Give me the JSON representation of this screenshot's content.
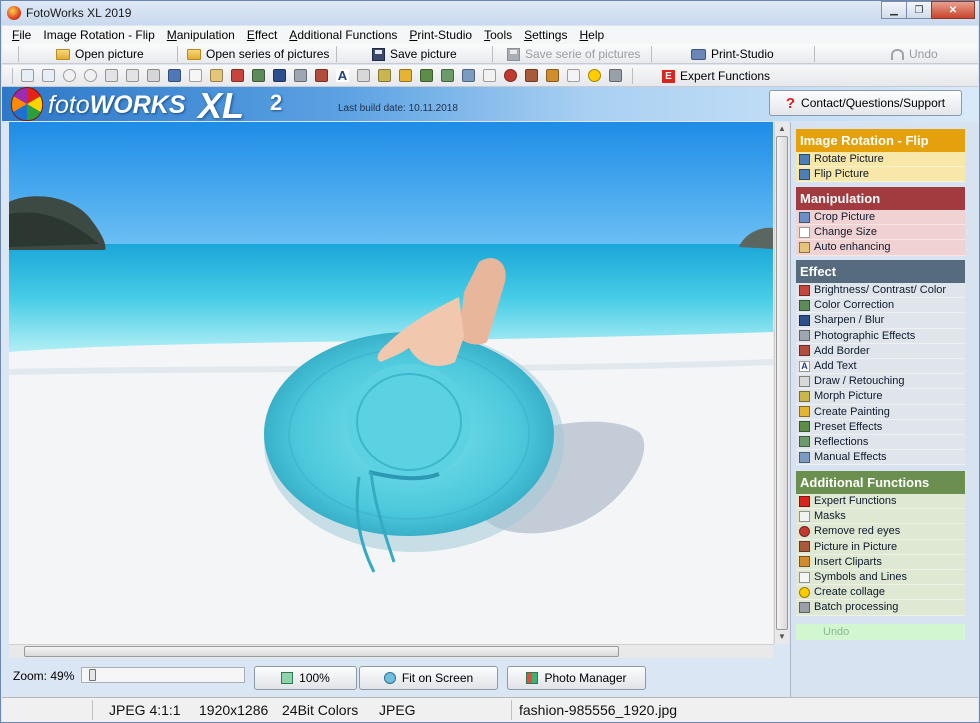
{
  "window": {
    "title": "FotoWorks XL 2019"
  },
  "menu": [
    {
      "label": "File",
      "accel": "F",
      "rest": "ile"
    },
    {
      "label": "Image Rotation - Flip",
      "accel": "",
      "rest": "Image Rotation - Flip"
    },
    {
      "label": "Manipulation",
      "accel": "M",
      "rest": "anipulation"
    },
    {
      "label": "Effect",
      "accel": "E",
      "rest": "ffect"
    },
    {
      "label": "Additional Functions",
      "accel": "A",
      "rest": "dditional Functions"
    },
    {
      "label": "Print-Studio",
      "accel": "P",
      "rest": "rint-Studio"
    },
    {
      "label": "Tools",
      "accel": "T",
      "rest": "ools"
    },
    {
      "label": "Settings",
      "accel": "S",
      "rest": "ettings"
    },
    {
      "label": "Help",
      "accel": "H",
      "rest": "elp"
    }
  ],
  "toolbar": {
    "open_picture": "Open picture",
    "open_series": "Open series of pictures",
    "save_picture": "Save picture",
    "save_series": "Save serie of pictures",
    "print_studio": "Print-Studio",
    "undo": "Undo",
    "expert": "Expert Functions"
  },
  "banner": {
    "logo_a": "foto",
    "logo_b": "WORKS",
    "logo_xl": "XL",
    "logo_num": "2",
    "build": "Last build date: 10.11.2018",
    "contact": "Contact/Questions/Support"
  },
  "panel": {
    "rotation": {
      "title": "Image Rotation - Flip",
      "color": "#e5a10b",
      "bg": "#f7e7a8",
      "items": [
        "Rotate Picture",
        "Flip Picture"
      ]
    },
    "manipulation": {
      "title": "Manipulation",
      "color": "#a13b3f",
      "bg": "#f1d2d2",
      "items": [
        "Crop Picture",
        "Change Size",
        "Auto enhancing"
      ]
    },
    "effect": {
      "title": "Effect",
      "color": "#566b7d",
      "bg": "#dfe5eb",
      "items": [
        "Brightness/ Contrast/ Color",
        "Color Correction",
        "Sharpen / Blur",
        "Photographic Effects",
        "Add Border",
        "Add Text",
        "Draw / Retouching",
        "Morph Picture",
        "Create Painting",
        "Preset Effects",
        "Reflections",
        "Manual Effects"
      ]
    },
    "additional": {
      "title": "Additional Functions",
      "color": "#6a8f4e",
      "bg": "#dfe8d3",
      "items": [
        "Expert Functions",
        "Masks",
        "Remove red eyes",
        "Picture in Picture",
        "Insert Cliparts",
        "Symbols and Lines",
        "Create collage",
        "Batch processing"
      ]
    },
    "undo": "Undo"
  },
  "bottom": {
    "zoom_label": "Zoom: 49%",
    "zoom_value": 49,
    "btn_100": "100%",
    "btn_fit": "Fit on Screen",
    "btn_manager": "Photo Manager"
  },
  "status": {
    "format": "JPEG  4:1:1",
    "dims": "1920x1286",
    "colors": "24Bit Colors",
    "type": "JPEG",
    "file": "fashion-985556_1920.jpg"
  }
}
